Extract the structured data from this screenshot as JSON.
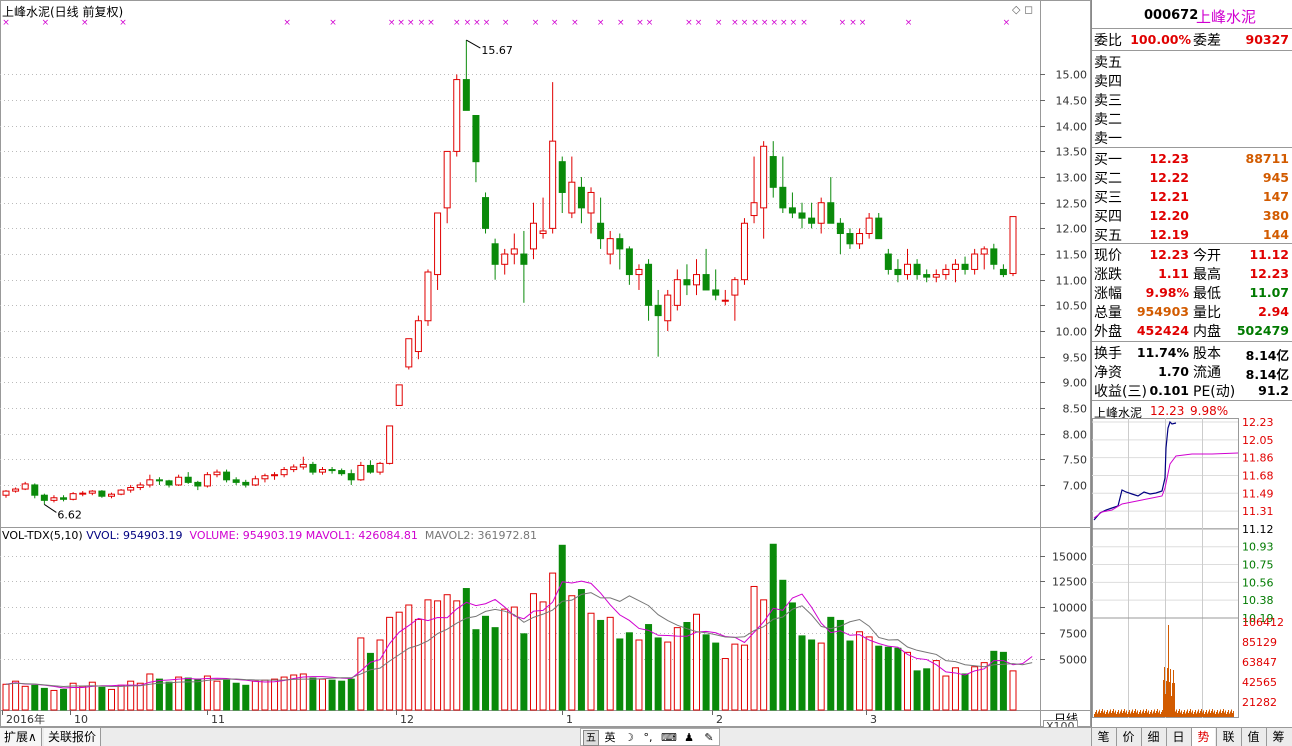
{
  "chart_header": {
    "title": "上峰水泥(日线 前复权)",
    "high_label": "15.67",
    "low_label": "6.62"
  },
  "price_axis": [
    "15.00",
    "14.50",
    "14.00",
    "13.50",
    "13.00",
    "12.50",
    "12.00",
    "11.50",
    "11.00",
    "10.50",
    "10.00",
    "9.50",
    "9.00",
    "8.50",
    "8.00",
    "7.50",
    "7.00"
  ],
  "vol_header": {
    "name": "VOL-TDX(5,10)",
    "vvol": "VVOL: 954903.19",
    "volume": "VOLUME: 954903.19",
    "mavol1": "MAVOL1: 426084.81",
    "mavol2": "MAVOL2: 361972.81"
  },
  "vol_axis": [
    "15000",
    "12500",
    "10000",
    "7500",
    "5000"
  ],
  "vol_unit": "X100",
  "date_axis": [
    "2016年",
    "10",
    "11",
    "12",
    "1",
    "2",
    "3"
  ],
  "period_label": "日线",
  "chart_data": {
    "type": "candlestick",
    "title": "上峰水泥(日线 前复权)",
    "ylim": [
      6.2,
      16.1
    ],
    "max_price": 15.67,
    "min_price": 6.62,
    "candles": [
      [
        6.8,
        6.9,
        6.75,
        6.88
      ],
      [
        6.88,
        6.95,
        6.85,
        6.92
      ],
      [
        6.92,
        7.06,
        6.9,
        7.02
      ],
      [
        7.0,
        7.03,
        6.74,
        6.8
      ],
      [
        6.8,
        6.83,
        6.62,
        6.7
      ],
      [
        6.7,
        6.8,
        6.66,
        6.75
      ],
      [
        6.75,
        6.8,
        6.68,
        6.72
      ],
      [
        6.72,
        6.86,
        6.7,
        6.83
      ],
      [
        6.83,
        6.88,
        6.78,
        6.84
      ],
      [
        6.84,
        6.9,
        6.8,
        6.88
      ],
      [
        6.88,
        6.9,
        6.75,
        6.78
      ],
      [
        6.78,
        6.85,
        6.74,
        6.82
      ],
      [
        6.82,
        6.92,
        6.8,
        6.9
      ],
      [
        6.9,
        7.0,
        6.85,
        6.95
      ],
      [
        6.95,
        7.05,
        6.9,
        7.0
      ],
      [
        7.0,
        7.2,
        6.95,
        7.1
      ],
      [
        7.1,
        7.15,
        7.0,
        7.08
      ],
      [
        7.08,
        7.1,
        6.95,
        7.0
      ],
      [
        7.0,
        7.2,
        6.98,
        7.15
      ],
      [
        7.15,
        7.25,
        7.02,
        7.05
      ],
      [
        7.05,
        7.08,
        6.9,
        6.98
      ],
      [
        6.98,
        7.25,
        6.95,
        7.2
      ],
      [
        7.2,
        7.3,
        7.15,
        7.25
      ],
      [
        7.25,
        7.3,
        7.05,
        7.1
      ],
      [
        7.1,
        7.15,
        7.0,
        7.05
      ],
      [
        7.05,
        7.1,
        6.95,
        7.0
      ],
      [
        7.0,
        7.18,
        6.98,
        7.12
      ],
      [
        7.12,
        7.22,
        7.05,
        7.18
      ],
      [
        7.18,
        7.25,
        7.1,
        7.2
      ],
      [
        7.2,
        7.35,
        7.15,
        7.3
      ],
      [
        7.3,
        7.4,
        7.25,
        7.35
      ],
      [
        7.35,
        7.55,
        7.3,
        7.4
      ],
      [
        7.4,
        7.45,
        7.2,
        7.25
      ],
      [
        7.25,
        7.35,
        7.2,
        7.3
      ],
      [
        7.3,
        7.35,
        7.22,
        7.28
      ],
      [
        7.28,
        7.32,
        7.18,
        7.22
      ],
      [
        7.22,
        7.3,
        7.0,
        7.1
      ],
      [
        7.1,
        7.45,
        7.08,
        7.38
      ],
      [
        7.38,
        7.48,
        7.22,
        7.25
      ],
      [
        7.25,
        7.45,
        7.2,
        7.42
      ],
      [
        7.42,
        8.15,
        7.4,
        8.15
      ],
      [
        8.55,
        8.95,
        8.55,
        8.95
      ],
      [
        9.3,
        9.85,
        9.25,
        9.85
      ],
      [
        9.6,
        10.3,
        9.45,
        10.2
      ],
      [
        10.2,
        11.2,
        10.1,
        11.15
      ],
      [
        11.1,
        12.3,
        10.8,
        12.3
      ],
      [
        12.4,
        13.5,
        12.1,
        13.5
      ],
      [
        13.5,
        15.0,
        13.4,
        14.9
      ],
      [
        14.9,
        15.67,
        14.3,
        14.3
      ],
      [
        14.2,
        13.9,
        12.9,
        13.3
      ],
      [
        12.6,
        12.7,
        11.9,
        12.0
      ],
      [
        11.7,
        11.8,
        11.0,
        11.3
      ],
      [
        11.3,
        11.6,
        11.1,
        11.5
      ],
      [
        11.5,
        11.9,
        11.3,
        11.6
      ],
      [
        11.5,
        11.95,
        10.55,
        11.3
      ],
      [
        11.6,
        12.5,
        11.4,
        12.1
      ],
      [
        11.9,
        12.6,
        11.8,
        11.95
      ],
      [
        12.0,
        14.85,
        11.9,
        13.7
      ],
      [
        13.3,
        13.4,
        12.3,
        12.7
      ],
      [
        12.3,
        13.4,
        12.2,
        12.9
      ],
      [
        12.8,
        13.0,
        12.1,
        12.4
      ],
      [
        12.3,
        12.8,
        11.9,
        12.7
      ],
      [
        12.1,
        12.6,
        11.6,
        11.8
      ],
      [
        11.5,
        11.95,
        11.3,
        11.8
      ],
      [
        11.8,
        11.9,
        11.2,
        11.6
      ],
      [
        11.6,
        11.65,
        10.9,
        11.1
      ],
      [
        11.1,
        11.3,
        10.8,
        11.2
      ],
      [
        11.3,
        11.4,
        10.2,
        10.5
      ],
      [
        10.5,
        10.8,
        9.5,
        10.3
      ],
      [
        10.2,
        10.8,
        10.0,
        10.7
      ],
      [
        10.5,
        11.2,
        10.4,
        11.0
      ],
      [
        11.0,
        11.3,
        10.7,
        10.9
      ],
      [
        10.9,
        11.4,
        10.7,
        11.1
      ],
      [
        11.1,
        11.6,
        10.8,
        10.8
      ],
      [
        10.8,
        11.2,
        10.6,
        10.7
      ],
      [
        10.6,
        10.8,
        10.5,
        10.6
      ],
      [
        10.7,
        11.05,
        10.2,
        11.0
      ],
      [
        11.0,
        12.2,
        10.9,
        12.1
      ],
      [
        12.25,
        13.4,
        12.1,
        12.5
      ],
      [
        12.4,
        13.7,
        11.8,
        13.6
      ],
      [
        13.4,
        13.7,
        12.6,
        12.8
      ],
      [
        12.8,
        13.4,
        12.3,
        12.4
      ],
      [
        12.4,
        12.7,
        12.2,
        12.3
      ],
      [
        12.3,
        12.5,
        12.0,
        12.2
      ],
      [
        12.2,
        12.5,
        12.0,
        12.1
      ],
      [
        12.1,
        12.6,
        11.9,
        12.5
      ],
      [
        12.5,
        13.0,
        12.1,
        12.1
      ],
      [
        12.1,
        12.2,
        11.5,
        11.9
      ],
      [
        11.9,
        12.0,
        11.6,
        11.7
      ],
      [
        11.7,
        12.0,
        11.6,
        11.9
      ],
      [
        11.9,
        12.3,
        11.8,
        12.2
      ],
      [
        12.2,
        12.3,
        11.8,
        11.8
      ],
      [
        11.5,
        11.6,
        11.1,
        11.2
      ],
      [
        11.2,
        11.4,
        10.95,
        11.1
      ],
      [
        11.1,
        11.6,
        11.0,
        11.3
      ],
      [
        11.3,
        11.4,
        11.0,
        11.1
      ],
      [
        11.1,
        11.2,
        10.95,
        11.05
      ],
      [
        11.05,
        11.2,
        10.95,
        11.1
      ],
      [
        11.1,
        11.3,
        11.0,
        11.2
      ],
      [
        11.2,
        11.4,
        10.95,
        11.3
      ],
      [
        11.3,
        11.45,
        11.1,
        11.2
      ],
      [
        11.2,
        11.6,
        11.1,
        11.5
      ],
      [
        11.5,
        11.65,
        11.2,
        11.6
      ],
      [
        11.6,
        11.7,
        11.2,
        11.3
      ],
      [
        11.2,
        11.3,
        11.05,
        11.1
      ],
      [
        11.12,
        12.23,
        11.07,
        12.23
      ]
    ],
    "volumes": [
      2500,
      2800,
      2300,
      2400,
      2100,
      1900,
      2000,
      2600,
      2300,
      2700,
      2200,
      2000,
      2400,
      2800,
      2600,
      3500,
      3000,
      2700,
      3200,
      3100,
      3000,
      3300,
      2800,
      2900,
      2600,
      2400,
      2800,
      2900,
      3000,
      3200,
      3400,
      3500,
      3100,
      3000,
      2900,
      2800,
      3000,
      7000,
      5500,
      6800,
      9000,
      9500,
      10200,
      8800,
      10700,
      10600,
      11200,
      10600,
      11800,
      7800,
      9100,
      8000,
      9800,
      10000,
      7400,
      11300,
      10500,
      13300,
      16000,
      11100,
      11700,
      9400,
      8700,
      9000,
      6900,
      7500,
      6800,
      8300,
      7000,
      6600,
      8000,
      8500,
      9300,
      7300,
      6500,
      5000,
      6400,
      6300,
      12000,
      10700,
      16100,
      12600,
      10400,
      7200,
      6800,
      6500,
      9000,
      8700,
      6700,
      7600,
      7100,
      6200,
      6100,
      6000,
      5600,
      3800,
      4000,
      4800,
      3300,
      4100,
      3500,
      4200,
      4600,
      5700,
      5600,
      3800,
      3700,
      9600
    ],
    "ma5_vol": [
      2500,
      2650,
      2530,
      2500,
      2420,
      2300,
      2140,
      2180,
      2180,
      2300,
      2360,
      2360,
      2420,
      2420,
      2400,
      2700,
      2860,
      2920,
      3000,
      3060,
      3000,
      3060,
      3080,
      3060,
      2960,
      2900,
      2780,
      2720,
      2740,
      2860,
      3060,
      3200,
      3240,
      3240,
      3180,
      3100,
      3060,
      3800,
      4640,
      4900,
      6460,
      7560,
      8200,
      8900,
      8680,
      8980,
      8960,
      9820,
      10460,
      10140,
      10320,
      10740,
      10000,
      9140,
      8860,
      9600,
      9680,
      10480,
      12460,
      12340,
      12520,
      12300,
      11360,
      10220,
      9240,
      8700,
      7920,
      7740,
      7260,
      7240,
      7180,
      7160,
      7560,
      7640,
      7500,
      7140,
      7060,
      6560,
      7540,
      8560,
      9880,
      9680,
      10880,
      11260,
      9980,
      8440,
      7520,
      7700,
      7260,
      7320,
      6800,
      6460,
      6200,
      6100,
      5400,
      5000,
      4900,
      4400,
      3700,
      3600,
      3400,
      3800,
      4000,
      4800,
      4800,
      4400,
      4500,
      5200
    ],
    "ma10_vol": [
      2500,
      2600,
      2550,
      2520,
      2440,
      2350,
      2280,
      2330,
      2330,
      2360,
      2320,
      2280,
      2290,
      2340,
      2360,
      2500,
      2610,
      2640,
      2710,
      2730,
      2750,
      2880,
      2960,
      2990,
      3010,
      2950,
      2920,
      2900,
      2900,
      2910,
      2980,
      3000,
      3000,
      3040,
      3090,
      3130,
      3130,
      3500,
      3910,
      4070,
      4760,
      5380,
      6000,
      6290,
      6720,
      7420,
      7850,
      8430,
      8930,
      9090,
      9580,
      9770,
      9600,
      9260,
      8520,
      9000,
      9310,
      9710,
      10560,
      10670,
      11230,
      11400,
      10890,
      10890,
      10550,
      11090,
      10620,
      10140,
      9260,
      8690,
      8240,
      7900,
      7610,
      7510,
      7310,
      7090,
      7050,
      7120,
      7720,
      8090,
      8820,
      9030,
      9790,
      10120,
      9240,
      8120,
      7900,
      8150,
      8570,
      8790,
      8140,
      7050,
      6800,
      6830,
      6120,
      5800,
      5600,
      5400,
      4800,
      4700,
      4400,
      4300,
      4200,
      4400,
      4450,
      4500,
      4400,
      4600
    ]
  },
  "right_panel": {
    "code": "000672",
    "name": "上峰水泥",
    "weibi_label": "委比",
    "weibi": "100.00%",
    "weicha_label": "委差",
    "weicha": "90327",
    "sells": [
      {
        "label": "卖五"
      },
      {
        "label": "卖四"
      },
      {
        "label": "卖三"
      },
      {
        "label": "卖二"
      },
      {
        "label": "卖一"
      }
    ],
    "buys": [
      {
        "label": "买一",
        "price": "12.23",
        "vol": "88711"
      },
      {
        "label": "买二",
        "price": "12.22",
        "vol": "945"
      },
      {
        "label": "买三",
        "price": "12.21",
        "vol": "147"
      },
      {
        "label": "买四",
        "price": "12.20",
        "vol": "380"
      },
      {
        "label": "买五",
        "price": "12.19",
        "vol": "144"
      }
    ],
    "quote": [
      {
        "k1": "现价",
        "v1": "12.23",
        "k2": "今开",
        "v2": "11.12"
      },
      {
        "k1": "涨跌",
        "v1": "1.11",
        "k2": "最高",
        "v2": "12.23"
      },
      {
        "k1": "涨幅",
        "v1": "9.98%",
        "k2": "最低",
        "v2": "11.07"
      },
      {
        "k1": "总量",
        "v1": "954903",
        "k2": "量比",
        "v2": "2.94"
      },
      {
        "k1": "外盘",
        "v1": "452424",
        "k2": "内盘",
        "v2": "502479"
      }
    ],
    "fund": [
      {
        "k1": "换手",
        "v1": "11.74%",
        "k2": "股本",
        "v2": "8.14亿"
      },
      {
        "k1": "净资",
        "v1": "1.70",
        "k2": "流通",
        "v2": "8.14亿"
      },
      {
        "k1": "收益(三)",
        "v1": "0.101",
        "k2": "PE(动)",
        "v2": "91.2"
      }
    ],
    "mini": {
      "name": "上峰水泥",
      "price": "12.23",
      "pct": "9.98%",
      "price_axis": [
        "12.23",
        "12.05",
        "11.86",
        "11.68",
        "11.49",
        "11.31",
        "11.12",
        "10.93",
        "10.75",
        "10.56",
        "10.38",
        "10.19"
      ],
      "vol_axis": [
        "106412",
        "85129",
        "63847",
        "42565",
        "21282"
      ]
    }
  },
  "bottom": {
    "tabs": [
      "扩展∧",
      "关联报价"
    ],
    "ime": [
      "五",
      "英",
      "☽",
      "°,",
      "⌨",
      "♟",
      "✎"
    ],
    "right_tabs": [
      "笔",
      "价",
      "细",
      "日",
      "势",
      "联",
      "值",
      "筹"
    ]
  }
}
